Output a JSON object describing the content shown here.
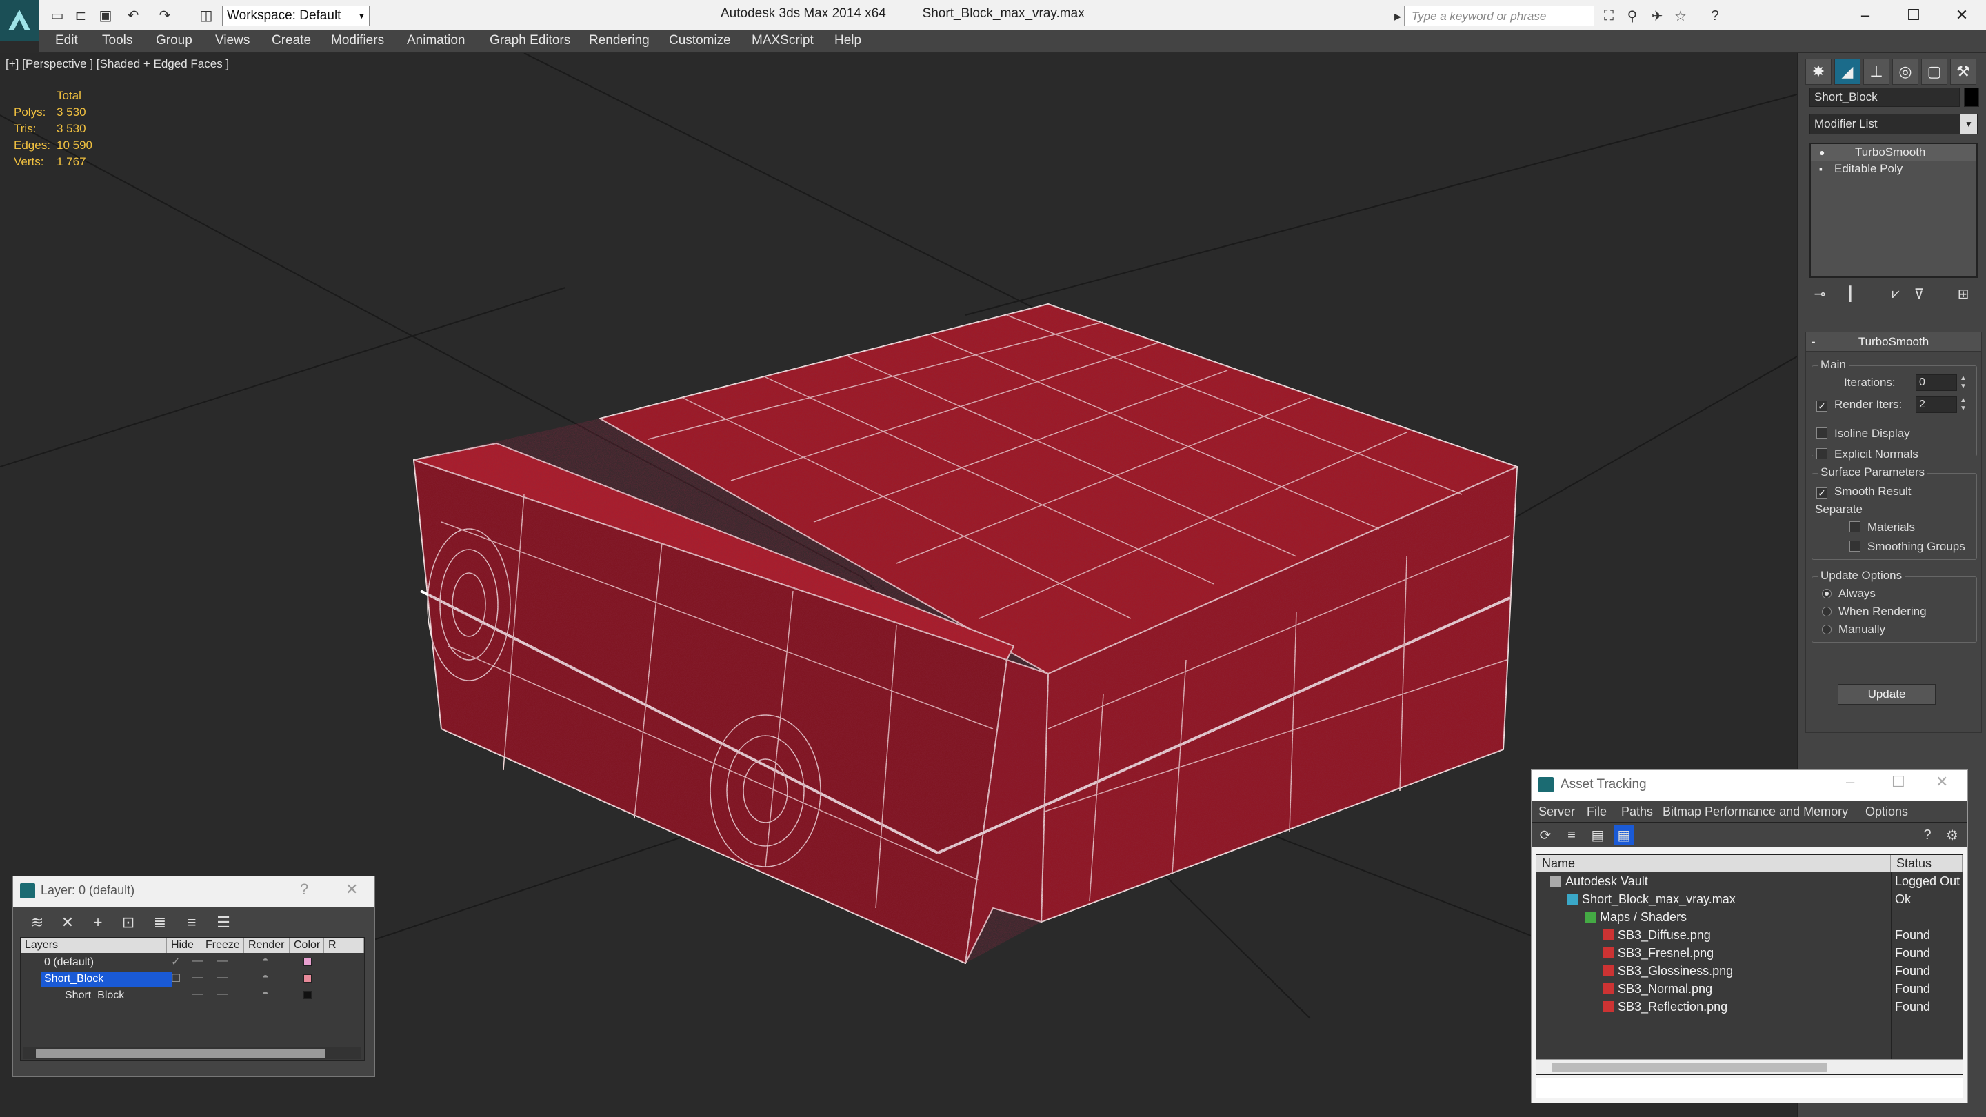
{
  "app": {
    "title_left": "Autodesk 3ds Max 2014 x64",
    "title_right": "Short_Block_max_vray.max",
    "workspace": "Workspace: Default",
    "search_placeholder": "Type a keyword or phrase"
  },
  "menu": [
    "Edit",
    "Tools",
    "Group",
    "Views",
    "Create",
    "Modifiers",
    "Animation",
    "Graph Editors",
    "Rendering",
    "Customize",
    "MAXScript",
    "Help"
  ],
  "viewport": {
    "label": "[+] [Perspective ] [Shaded + Edged Faces ]",
    "stats_header": "Total",
    "stats": [
      {
        "k": "Polys:",
        "v": "3 530"
      },
      {
        "k": "Tris:",
        "v": "3 530"
      },
      {
        "k": "Edges:",
        "v": "10 590"
      },
      {
        "k": "Verts:",
        "v": "1 767"
      }
    ]
  },
  "command_panel": {
    "object_name": "Short_Block",
    "modifier_list": "Modifier List",
    "stack": [
      "TurboSmooth",
      "Editable Poly"
    ],
    "rollout": {
      "title": "TurboSmooth",
      "main": "Main",
      "iterations_label": "Iterations:",
      "iterations": "0",
      "render_iters_label": "Render Iters:",
      "render_iters": "2",
      "isoline": "Isoline Display",
      "explicit": "Explicit Normals",
      "surface": "Surface Parameters",
      "smooth_result": "Smooth Result",
      "separate": "Separate",
      "materials": "Materials",
      "smoothing_groups": "Smoothing Groups",
      "update_options": "Update Options",
      "always": "Always",
      "when_rendering": "When Rendering",
      "manually": "Manually",
      "update": "Update"
    }
  },
  "layer_panel": {
    "title": "Layer: 0 (default)",
    "help": "?",
    "columns": [
      "Layers",
      "Hide",
      "Freeze",
      "Render",
      "Color",
      "R"
    ],
    "rows": [
      {
        "name": "0 (default)",
        "color": "#e8a0d0"
      },
      {
        "name": "Short_Block",
        "color": "#e88a9a"
      },
      {
        "name": "Short_Block",
        "color": "#111111"
      }
    ]
  },
  "asset_tracking": {
    "title": "Asset Tracking",
    "menu": [
      "Server",
      "File",
      "Paths",
      "Bitmap Performance and Memory",
      "Options"
    ],
    "columns": [
      "Name",
      "Status"
    ],
    "rows": [
      {
        "name": "Autodesk Vault",
        "status": "Logged Out"
      },
      {
        "name": "Short_Block_max_vray.max",
        "status": "Ok"
      },
      {
        "name": "Maps / Shaders",
        "status": ""
      },
      {
        "name": "SB3_Diffuse.png",
        "status": "Found"
      },
      {
        "name": "SB3_Fresnel.png",
        "status": "Found"
      },
      {
        "name": "SB3_Glossiness.png",
        "status": "Found"
      },
      {
        "name": "SB3_Normal.png",
        "status": "Found"
      },
      {
        "name": "SB3_Reflection.png",
        "status": "Found"
      }
    ]
  },
  "colors": {
    "accent": "#1a5ad6",
    "model_red": "#a01822",
    "stats_yellow": "#f0c040"
  }
}
